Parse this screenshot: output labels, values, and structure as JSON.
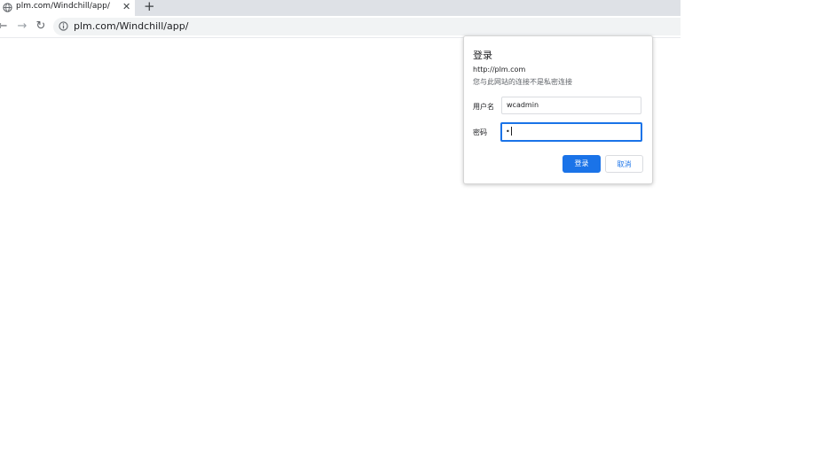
{
  "browser": {
    "tab_title": "plm.com/Windchill/app/",
    "tab_close_glyph": "✕",
    "new_tab_glyph": "+",
    "back_glyph": "←",
    "forward_glyph": "→",
    "reload_glyph": "↻",
    "url": "plm.com/Windchill/app/"
  },
  "dialog": {
    "title": "登录",
    "site": "http://plm.com",
    "warning": "您与此网站的连接不是私密连接",
    "username_label": "用户名",
    "username_value": "wcadmin",
    "password_label": "密码",
    "password_value": "•",
    "login_button": "登录",
    "cancel_button": "取消"
  },
  "colors": {
    "accent": "#1a73e8",
    "tab_strip": "#dee1e6",
    "omnibox": "#f1f3f4"
  }
}
